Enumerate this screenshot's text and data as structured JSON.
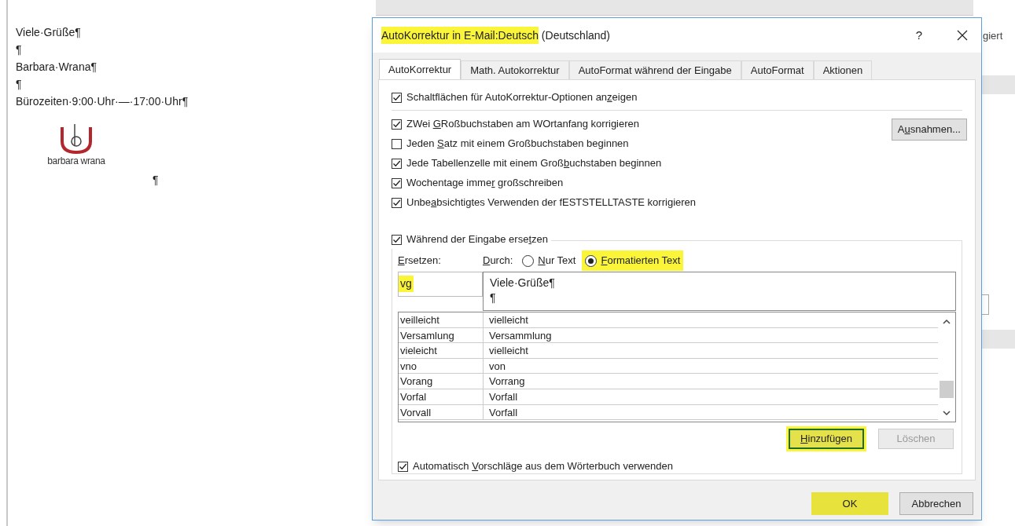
{
  "document": {
    "lines": [
      "Viele·Grüße¶",
      "¶",
      "Barbara·Wrana¶",
      "¶",
      "Bürozeiten·9:00·Uhr·—·17:00·Uhr¶"
    ],
    "logo_text": "barbara wrana",
    "after_logo": "¶"
  },
  "background_window": {
    "fragment": "giert"
  },
  "dialog": {
    "title_parts": [
      {
        "text": "AutoKorrektur in E-Mail:Deutsch",
        "highlighted": true
      },
      {
        "text": "(Deutschland)",
        "highlighted": false
      }
    ],
    "help": "?",
    "tabs": [
      {
        "label": "AutoKorrektur",
        "selected": true
      },
      {
        "label": "Math. Autokorrektur",
        "selected": false
      },
      {
        "label": "AutoFormat während der Eingabe",
        "selected": false
      },
      {
        "label": "AutoFormat",
        "selected": false
      },
      {
        "label": "Aktionen",
        "selected": false
      }
    ],
    "top_option": {
      "checked": true,
      "label": [
        {
          "text": "Schaltflächen für AutoKorrektur-Optionen an",
          "underlined": false
        },
        {
          "text": "z",
          "underlined": true
        },
        {
          "text": "eigen",
          "underlined": false
        }
      ]
    },
    "options": [
      {
        "checked": true,
        "label": [
          {
            "text": "ZWei ",
            "underlined": false
          },
          {
            "text": "G",
            "underlined": true
          },
          {
            "text": "Roßbuchstaben am WOrtanfang korrigieren",
            "underlined": false
          }
        ]
      },
      {
        "checked": false,
        "label": [
          {
            "text": "Jeden ",
            "underlined": false
          },
          {
            "text": "S",
            "underlined": true
          },
          {
            "text": "atz mit einem Großbuchstaben beginnen",
            "underlined": false
          }
        ]
      },
      {
        "checked": true,
        "label": [
          {
            "text": "Jede Tabellenzelle mit einem Groß",
            "underlined": false
          },
          {
            "text": "b",
            "underlined": true
          },
          {
            "text": "uchstaben beginnen",
            "underlined": false
          }
        ]
      },
      {
        "checked": true,
        "label": [
          {
            "text": "Wochentage imme",
            "underlined": false
          },
          {
            "text": "r",
            "underlined": true
          },
          {
            "text": " großschreiben",
            "underlined": false
          }
        ]
      },
      {
        "checked": true,
        "label": [
          {
            "text": "Unbe",
            "underlined": false
          },
          {
            "text": "a",
            "underlined": true
          },
          {
            "text": "bsichtigtes Verwenden der fESTSTELLTASTE korrigieren",
            "underlined": false
          }
        ]
      }
    ],
    "exceptions_button": {
      "label": [
        {
          "text": "A",
          "underlined": false
        },
        {
          "text": "u",
          "underlined": true
        },
        {
          "text": "snahmen...",
          "underlined": false
        }
      ]
    },
    "replace_group": {
      "checked": true,
      "label": [
        {
          "text": "Während der Eingabe erse",
          "underlined": false
        },
        {
          "text": "t",
          "underlined": true
        },
        {
          "text": "zen",
          "underlined": false
        }
      ]
    },
    "replace_label": [
      {
        "text": "E",
        "underlined": true
      },
      {
        "text": "rsetzen:",
        "underlined": false
      }
    ],
    "with_label": [
      {
        "text": "D",
        "underlined": true
      },
      {
        "text": "urch:",
        "underlined": false
      }
    ],
    "radios": [
      {
        "selected": false,
        "highlighted": false,
        "label": [
          {
            "text": "N",
            "underlined": true
          },
          {
            "text": "ur Text",
            "underlined": false
          }
        ]
      },
      {
        "selected": true,
        "highlighted": true,
        "label": [
          {
            "text": "F",
            "underlined": true
          },
          {
            "text": "ormatierten Text",
            "underlined": false
          }
        ]
      }
    ],
    "replace_field": {
      "value": "vg",
      "highlighted": true
    },
    "with_field": {
      "lines": [
        "Viele·Grüße¶",
        "¶"
      ]
    },
    "entries": [
      {
        "replace": "veilleicht",
        "with": "vielleicht"
      },
      {
        "replace": "Versamlung",
        "with": "Versammlung"
      },
      {
        "replace": "vieleicht",
        "with": "vielleicht"
      },
      {
        "replace": "vno",
        "with": "von"
      },
      {
        "replace": "Vorang",
        "with": "Vorrang"
      },
      {
        "replace": "Vorfal",
        "with": "Vorfall"
      },
      {
        "replace": "Vorvall",
        "with": "Vorfall"
      }
    ],
    "list_buttons": [
      {
        "label": [
          {
            "text": "H",
            "underlined": true
          },
          {
            "text": "inzufügen",
            "underlined": false
          }
        ],
        "highlighted": true,
        "disabled": false
      },
      {
        "label": [
          {
            "text": "Löschen",
            "underlined": false
          }
        ],
        "highlighted": false,
        "disabled": true
      }
    ],
    "suggest_option": {
      "checked": true,
      "label": [
        {
          "text": "Automatisch ",
          "underlined": false
        },
        {
          "text": "V",
          "underlined": true
        },
        {
          "text": "orschläge aus dem Wörterbuch verwenden",
          "underlined": false
        }
      ]
    },
    "footer_buttons": [
      {
        "label": "OK",
        "highlighted": true
      },
      {
        "label": "Abbrechen",
        "highlighted": false
      }
    ]
  }
}
